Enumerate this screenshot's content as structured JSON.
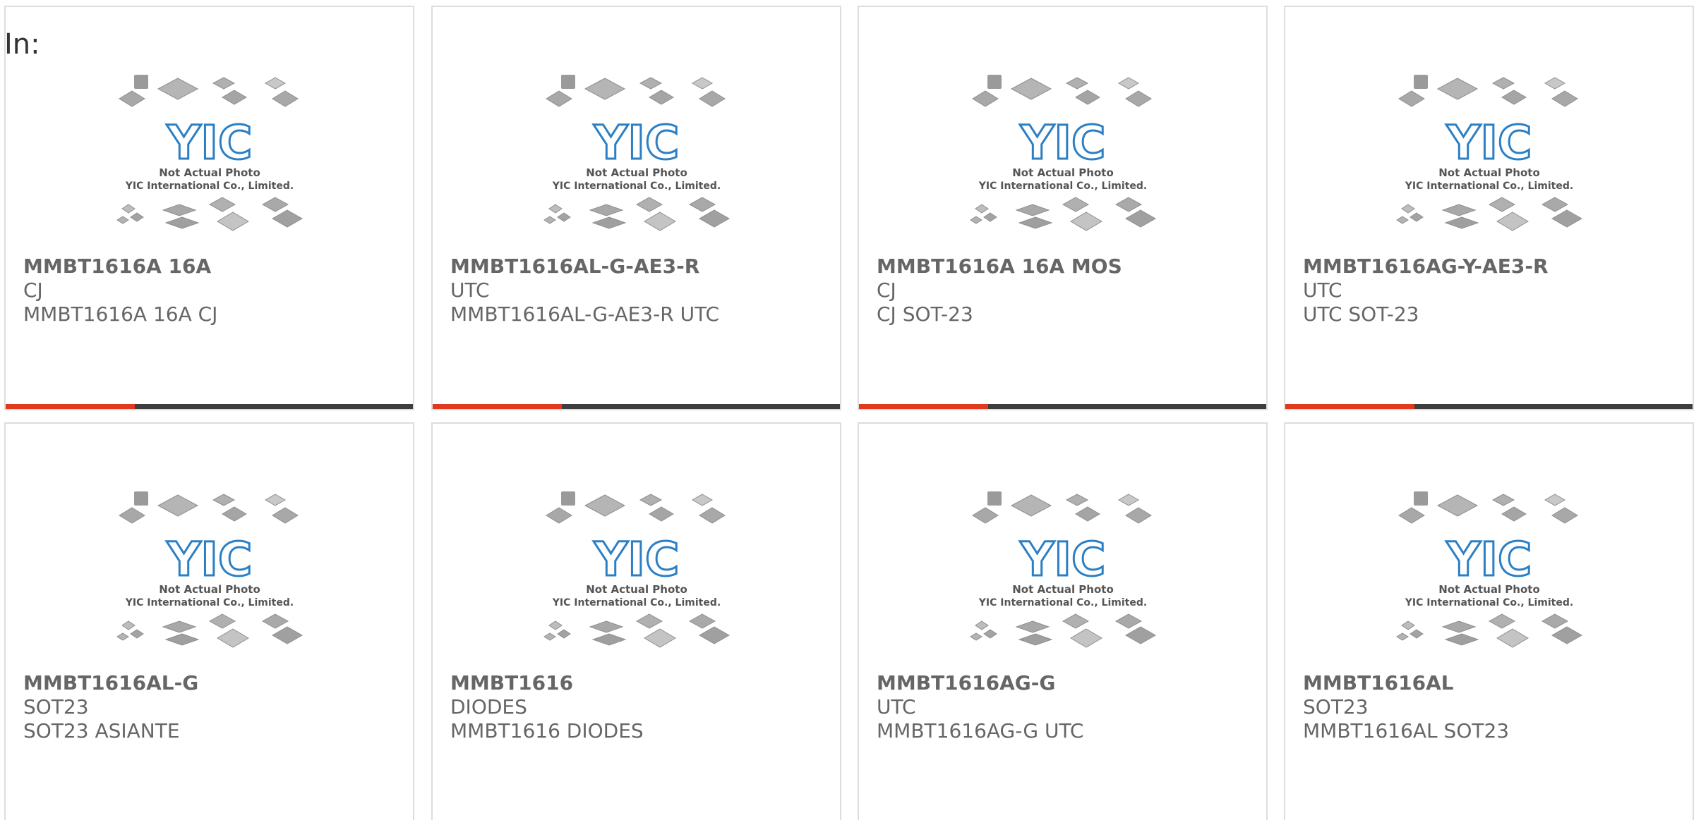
{
  "header": {
    "label": "In:"
  },
  "image": {
    "caption_line1": "Not Actual Photo",
    "caption_line2": "YIC International Co., Limited.",
    "logo_text": "YIC"
  },
  "colors": {
    "accent": "#e0391d",
    "bar": "#3e3e3e",
    "text": "#666666",
    "border": "#dddddd",
    "logo": "#2b7fc4"
  },
  "products": [
    {
      "title": "MMBT1616A 16A",
      "brand": "CJ",
      "desc": "MMBT1616A 16A CJ"
    },
    {
      "title": "MMBT1616AL-G-AE3-R",
      "brand": "UTC",
      "desc": "MMBT1616AL-G-AE3-R UTC"
    },
    {
      "title": "MMBT1616A 16A MOS",
      "brand": "CJ",
      "desc": "CJ SOT-23"
    },
    {
      "title": "MMBT1616AG-Y-AE3-R",
      "brand": "UTC",
      "desc": "UTC SOT-23"
    },
    {
      "title": "MMBT1616AL-G",
      "brand": "SOT23",
      "desc": "SOT23 ASIANTE"
    },
    {
      "title": "MMBT1616",
      "brand": "DIODES",
      "desc": "MMBT1616 DIODES"
    },
    {
      "title": "MMBT1616AG-G",
      "brand": "UTC",
      "desc": "MMBT1616AG-G UTC"
    },
    {
      "title": "MMBT1616AL",
      "brand": "SOT23",
      "desc": "MMBT1616AL SOT23"
    }
  ]
}
